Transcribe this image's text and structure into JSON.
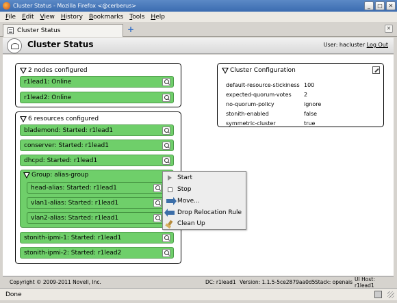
{
  "window": {
    "title": "Cluster Status - Mozilla Firefox <@cerberus>",
    "controls": [
      "_",
      "□",
      "✕"
    ]
  },
  "menubar": [
    "File",
    "Edit",
    "View",
    "History",
    "Bookmarks",
    "Tools",
    "Help"
  ],
  "tabs": {
    "active": "Cluster Status",
    "new_tab": "+",
    "close": "✕"
  },
  "header": {
    "title": "Cluster Status",
    "user_label": "User: hacluster",
    "logout": "Log Out"
  },
  "nodes_panel": {
    "title": "2 nodes configured",
    "nodes": [
      "r1lead1: Online",
      "r1lead2: Online"
    ]
  },
  "resources_panel": {
    "title": "6 resources configured",
    "resources_top": [
      "blademond: Started: r1lead1",
      "conserver: Started: r1lead1",
      "dhcpd: Started: r1lead1"
    ],
    "group": {
      "title": "Group: alias-group",
      "members": [
        "head-alias: Started: r1lead1",
        "vlan1-alias: Started: r1lead1",
        "vlan2-alias: Started: r1lead1"
      ]
    },
    "resources_bottom": [
      "stonith-ipmi-1: Started: r1lead1",
      "stonith-ipmi-2: Started: r1lead2"
    ]
  },
  "config_panel": {
    "title": "Cluster Configuration",
    "rows": [
      {
        "key": "default-resource-stickiness",
        "value": "100"
      },
      {
        "key": "expected-quorum-votes",
        "value": "2"
      },
      {
        "key": "no-quorum-policy",
        "value": "ignore"
      },
      {
        "key": "stonith-enabled",
        "value": "false"
      },
      {
        "key": "symmetric-cluster",
        "value": "true"
      }
    ]
  },
  "context_menu": {
    "items": [
      {
        "label": "Start",
        "icon": "play-icon"
      },
      {
        "label": "Stop",
        "icon": "stop-icon"
      },
      {
        "label": "Move...",
        "icon": "move-arrow-icon"
      },
      {
        "label": "Drop Relocation Rule",
        "icon": "drop-arrow-icon"
      },
      {
        "label": "Clean Up",
        "icon": "broom-icon"
      }
    ]
  },
  "footer": {
    "copyright": "Copyright © 2009-2011 Novell, Inc.",
    "dc": "DC: r1lead1",
    "version": "Version: 1.1.5-5ce2879aa0d5",
    "stack": "Stack: openais",
    "ui_host": "UI Host: r1lead1"
  },
  "statusbar": {
    "text": "Done"
  }
}
